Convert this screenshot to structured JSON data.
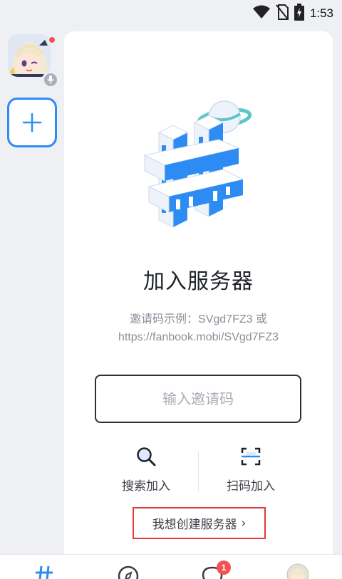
{
  "status_bar": {
    "time": "1:53",
    "icons": [
      "wifi-icon",
      "no-sim-icon",
      "battery-charging-icon"
    ]
  },
  "sidebar": {
    "server_avatar_icon": "anime-girl-avatar",
    "has_unread": true,
    "voice_indicator_icon": "microphone-icon",
    "add_server_icon": "plus-icon",
    "accent_color": "#2c8cf4"
  },
  "main": {
    "illustration_icon": "hashtag-planet-illustration",
    "title": "加入服务器",
    "hint_line1": "邀请码示例：SVgd7FZ3 或",
    "hint_line2": "https://fanbook.mobi/SVgd7FZ3",
    "invite_placeholder": "输入邀请码",
    "actions": [
      {
        "label": "搜索加入",
        "icon": "search-icon"
      },
      {
        "label": "扫码加入",
        "icon": "scan-icon"
      }
    ],
    "create_link_label": "我想创建服务器",
    "create_link_chevron": "›",
    "highlight_color": "#e23a3a"
  },
  "bottom_nav": {
    "items": [
      {
        "icon": "hashtag-icon",
        "active": true
      },
      {
        "icon": "compass-icon",
        "active": false
      },
      {
        "icon": "chat-bubble-icon",
        "active": false
      },
      {
        "icon": "user-avatar-icon",
        "active": false
      }
    ],
    "badge_count": "1"
  }
}
